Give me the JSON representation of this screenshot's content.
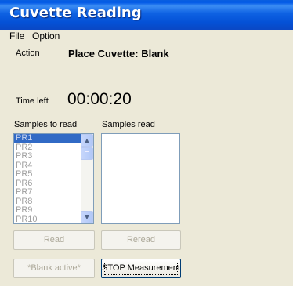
{
  "window": {
    "title": "Cuvette Reading"
  },
  "menu": {
    "items": [
      "File",
      "Option"
    ]
  },
  "action": {
    "label": "Action",
    "value": "Place Cuvette: Blank"
  },
  "time": {
    "label": "Time left",
    "value": "00:00:20"
  },
  "samples_to_read": {
    "label": "Samples to read",
    "items": [
      "PR1",
      "PR2",
      "PR3",
      "PR4",
      "PR5",
      "PR6",
      "PR7",
      "PR8",
      "PR9",
      "PR10"
    ],
    "selected_index": 0
  },
  "samples_read": {
    "label": "Samples read",
    "items": []
  },
  "buttons": {
    "read": "Read",
    "reread": "Reread",
    "blank": "*Blank active*",
    "stop": "STOP Measurement"
  },
  "icons": {
    "scroll_up": "arrow-up-icon",
    "scroll_down": "arrow-down-icon"
  },
  "colors": {
    "titlebar": "#0058e6",
    "selection": "#316ac5",
    "face": "#ece9d8"
  }
}
